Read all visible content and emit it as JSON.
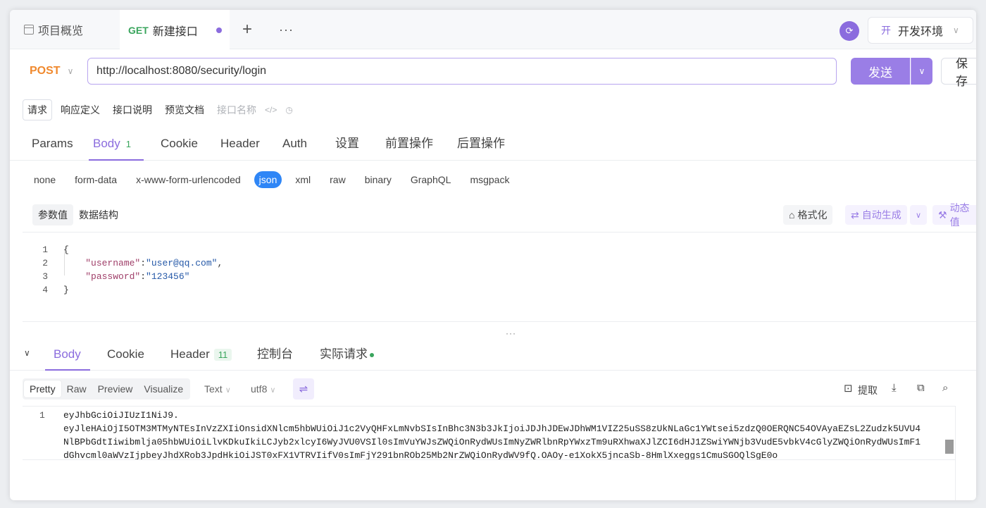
{
  "tabs": {
    "overview": "项目概览",
    "active_method": "GET",
    "active_name": "新建接口",
    "plus": "+",
    "more": "···"
  },
  "env": {
    "badge": "开",
    "label": "开发环境"
  },
  "request": {
    "method": "POST",
    "url": "http://localhost:8080/security/login",
    "send_label": "发送",
    "save_label": "保 存"
  },
  "subtabs": [
    "请求",
    "响应定义",
    "接口说明",
    "预览文档",
    "接口名称"
  ],
  "req_tabs": {
    "params": "Params",
    "body": "Body",
    "body_count": "1",
    "cookie": "Cookie",
    "header": "Header",
    "auth": "Auth",
    "settings": "设置",
    "pre": "前置操作",
    "post": "后置操作"
  },
  "body_types": [
    "none",
    "form-data",
    "x-www-form-urlencoded",
    "json",
    "xml",
    "raw",
    "binary",
    "GraphQL",
    "msgpack"
  ],
  "param_tabs": [
    "参数值",
    "数据结构"
  ],
  "tools": {
    "format": "格式化",
    "auto": "自动生成",
    "dynamic": "动态值"
  },
  "editor": {
    "line_numbers": [
      "1",
      "2",
      "3",
      "4"
    ],
    "open_brace": "{",
    "close_brace": "}",
    "username_key": "\"username\"",
    "username_value": "\"user@qq.com\"",
    "password_key": "\"password\"",
    "password_value": "\"123456\""
  },
  "resp_tabs": {
    "body": "Body",
    "cookie": "Cookie",
    "header": "Header",
    "header_count": "11",
    "console": "控制台",
    "actual": "实际请求"
  },
  "view": {
    "options": [
      "Pretty",
      "Raw",
      "Preview",
      "Visualize"
    ],
    "format": "Text",
    "encoding": "utf8",
    "extract": "提取"
  },
  "response": {
    "line_number": "1",
    "lines": [
      "eyJhbGciOiJIUzI1NiJ9.",
      "eyJleHAiOjI5OTM3MTMyNTEsInVzZXIiOnsidXNlcm5hbWUiOiJ1c2VyQHFxLmNvbSIsInBhc3N3b3JkIjoiJDJhJDEwJDhWM1VIZ25uSS8zUkNLaGc1YWtsei5zdzQ0OERQNC54OVAyaEZsL2Zudzk5UVU4",
      "NlBPbGdtIiwibmlja05hbWUiOiLlvKDkuIkiLCJyb2xlcyI6WyJVU0VSIl0sImVuYWJsZWQiOnRydWUsImNyZWRlbnRpYWxzTm9uRXhwaXJlZCI6dHJ1ZSwiYWNjb3VudE5vbkV4cGlyZWQiOnRydWUsImF1",
      "dGhvcml0aWVzIjpbeyJhdXRob3JpdHkiOiJST0xFX1VTRVIifV0sImFjY291bnROb25Mb2NrZWQiOnRydWV9fQ.OAOy-e1XokX5jncaSb-8HmlXxeggs1CmuSGOQlSgE0o"
    ]
  },
  "colors": {
    "accent": "#8b6cde",
    "method_post": "#f0892e",
    "method_get": "#3aa55d",
    "json_active": "#2f86f6"
  }
}
